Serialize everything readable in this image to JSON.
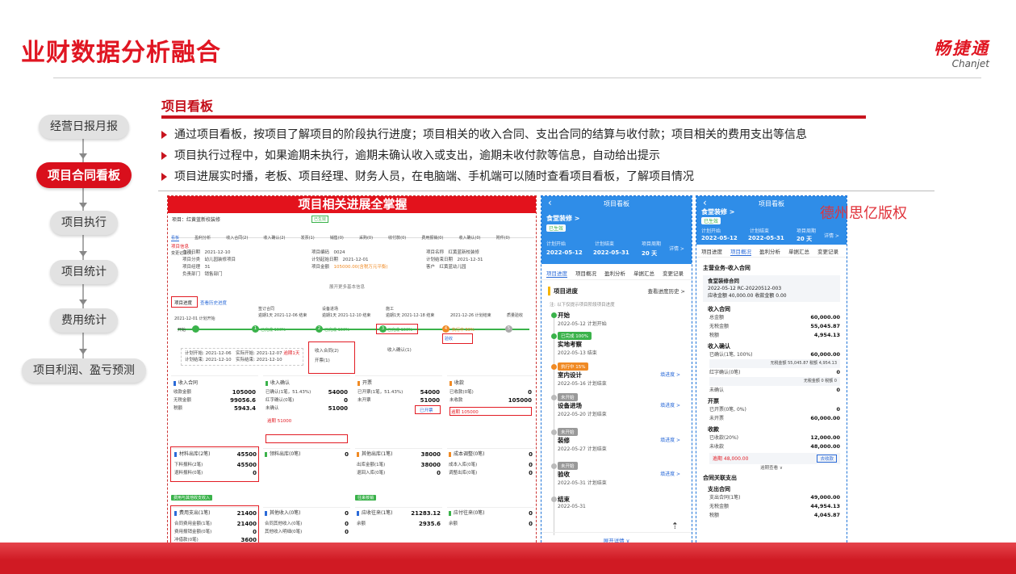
{
  "slide": {
    "title": "业财数据分析融合",
    "logo_cn": "畅捷通",
    "logo_en": "Chanjet"
  },
  "flow": {
    "steps": [
      {
        "label": "经营日报月报",
        "active": false
      },
      {
        "label": "项目合同看板",
        "active": true
      },
      {
        "label": "项目执行",
        "active": false
      },
      {
        "label": "项目统计",
        "active": false
      },
      {
        "label": "费用统计",
        "active": false
      },
      {
        "label": "项目利润、盈亏预测",
        "active": false
      }
    ]
  },
  "section": {
    "heading": "项目看板",
    "bullets": [
      "通过项目看板，按项目了解项目的阶段执行进度；项目相关的收入合同、支出合同的结算与收付款；项目相关的费用支出等信息",
      "项目执行过程中，如果逾期未执行，逾期未确认收入或支出，逾期未收付款等信息，自动给出提示",
      "项目进展实时播，老板、项目经理、财务人员，在电脑端、手机端可以随时查看项目看板，了解项目情况"
    ]
  },
  "pc": {
    "banner": "项目相关进展全掌握",
    "project": "项目：红黄蓝新校装修",
    "status": "已生效",
    "tabs": [
      "看板",
      "盈利分析",
      "收入合同(2)",
      "收入确认(2)",
      "发票(1)",
      "销售(0)",
      "采购(0)",
      "收付款(0)",
      "费用报销(0)",
      "收入确认(0)",
      "附件(0)",
      "变更记录(0)"
    ],
    "info_label": "项目信息",
    "info": [
      [
        "立项日期",
        "2021-12-10"
      ],
      [
        "项目分类",
        "幼儿园装修项目"
      ],
      [
        "项目经理",
        "31"
      ],
      [
        "负责部门",
        "销售部门"
      ]
    ],
    "info2": [
      [
        "项目编码",
        "0024"
      ],
      [
        "计划起始日期",
        "2021-12-01"
      ],
      [
        "项目金额",
        "105000.00(含税万元平衡)"
      ]
    ],
    "info3": [
      [
        "项目名称",
        "红黄蓝新校装修"
      ],
      [
        "计划结束日期",
        "2021-12-31"
      ],
      [
        "客户",
        "红黄蓝幼儿园"
      ]
    ],
    "expand": "展开更多基本信息",
    "progress_label": "项目进度",
    "progress_link": "查看历史进度",
    "stages": [
      {
        "name": "开始",
        "date": "2021-12-01 计划开始",
        "state": "done"
      },
      {
        "name": "签订合同",
        "date": "逾期1天 2021-12-06 结束",
        "state": "done",
        "badge": "已完成 100%"
      },
      {
        "name": "设备进场",
        "date": "逾期1天 2021-12-10 结束",
        "state": "done",
        "badge": "已完成 100%"
      },
      {
        "name": "施工",
        "date": "逾期1天 2021-12-18 结束",
        "state": "done",
        "badge": "已完成 100%"
      },
      {
        "name": "验收",
        "date": "2021-12-26 计划结束",
        "state": "doing",
        "badge": "执行中 50%"
      },
      {
        "name": "质量验收",
        "date": "2021-12-31",
        "state": "todo"
      }
    ],
    "plan_lines": [
      "计划开始: 2021-12-06",
      "计划结束: 2021-12-10",
      "实际开始: 2021-12-07",
      "实际结束: 2021-12-10",
      "逾期1天"
    ],
    "sub_links": [
      "收入合同(2)",
      "开票(1)",
      "收入确认(1)"
    ],
    "cards_row1": [
      {
        "title": "收入合同",
        "color": "blue",
        "lines": [
          [
            "收款金额",
            "105000"
          ],
          [
            "无税金额",
            "99056.6"
          ],
          [
            "税额",
            "5943.4"
          ]
        ]
      },
      {
        "title": "收入确认",
        "color": "green",
        "lines": [
          [
            "已确认(1笔，51.43%)",
            "54000"
          ],
          [
            "红字确认(0笔)",
            "0"
          ],
          [
            "未确认",
            "51000"
          ]
        ],
        "alert": "逾期 51000"
      },
      {
        "title": "开票",
        "color": "orange",
        "lines": [
          [
            "已开票(1笔，51.43%)",
            "54000"
          ],
          [
            "未开票",
            "51000"
          ]
        ],
        "alert": "已开票"
      },
      {
        "title": "收款",
        "color": "orange",
        "lines": [
          [
            "已收款(0笔)",
            "0"
          ],
          [
            "未收款",
            "105000"
          ]
        ],
        "alert": "逾期 105000"
      }
    ],
    "cards_row2": [
      {
        "title": "材料出库(2笔)",
        "lines": [
          [
            "下料报料(2笔)",
            "45500"
          ],
          [
            "退料报料(0笔)",
            "0"
          ]
        ],
        "value": "45500"
      },
      {
        "title": "领料出库(0笔)",
        "lines": [],
        "value": "0"
      },
      {
        "title": "其他出库(1笔)",
        "lines": [
          [
            "出库金额(1笔)",
            "38000"
          ],
          [
            "退回入库(0笔)",
            "0"
          ]
        ],
        "value": "38000"
      },
      {
        "title": "成本调整(0笔)",
        "lines": [
          [
            "成本入库(0笔)",
            "0"
          ],
          [
            "调整出库(0笔)",
            "0"
          ]
        ],
        "value": "0"
      }
    ],
    "section_tags": [
      "费用与其他收支收入",
      "往来核销"
    ],
    "cards_row3": [
      {
        "title": "费用支出(1笔)",
        "value": "21400",
        "lines": [
          [
            "合同费用金额(1笔)",
            "21400"
          ],
          [
            "费用报销金额(0笔)",
            "0"
          ],
          [
            "冲借款(0笔)",
            "3600"
          ]
        ]
      },
      {
        "title": "其他收入(0笔)",
        "value": "0",
        "lines": [
          [
            "合同其他收入(0笔)",
            "0"
          ],
          [
            "其他收入明细(0笔)",
            "0"
          ]
        ]
      },
      {
        "title": "应收往来(1笔)",
        "value": "21283.12",
        "lines": [
          [
            "余额",
            "2935.6"
          ]
        ]
      },
      {
        "title": "应付往来(0笔)",
        "value": "0",
        "lines": [
          [
            "余额",
            "0"
          ]
        ]
      }
    ]
  },
  "phone1": {
    "header": "项目看板",
    "project": "食堂装修 >",
    "status": "已生效",
    "meta": [
      {
        "label": "计划开始",
        "value": "2022-05-12"
      },
      {
        "label": "计划结束",
        "value": "2022-05-31"
      },
      {
        "label": "项目周期",
        "value": "20 天"
      }
    ],
    "detail": "详情 >",
    "tabs": [
      "项目进度",
      "项目概况",
      "盈利分析",
      "单据汇总",
      "变更记录"
    ],
    "section": "项目进度",
    "history": "查看进度历史 >",
    "hint": "注: 以下仅提示项目阶段项目进度",
    "steps": [
      {
        "name": "开始",
        "date": "2022-05-12",
        "note": "计划开始",
        "badge": ""
      },
      {
        "name": "实地考察",
        "date": "2022-05-13",
        "note": "结束",
        "badge": "已完成 100%",
        "badge_color": "#3ab24a"
      },
      {
        "name": "室内设计",
        "date": "2022-05-16",
        "note": "计划结束",
        "badge": "执行中 15%",
        "badge_color": "#f08a24",
        "link": "填进度 >"
      },
      {
        "name": "设备进场",
        "date": "2022-05-20",
        "note": "计划结束",
        "badge": "未开始",
        "badge_color": "#999",
        "link": "填进度 >"
      },
      {
        "name": "装修",
        "date": "2022-05-27",
        "note": "计划结束",
        "badge": "未开始",
        "badge_color": "#999",
        "link": "填进度 >"
      },
      {
        "name": "验收",
        "date": "2022-05-31",
        "note": "计划结束",
        "badge": "未开始",
        "badge_color": "#999",
        "link": "填进度 >"
      },
      {
        "name": "结束",
        "date": "2022-05-31",
        "note": "",
        "badge": ""
      }
    ],
    "footer": "展开详情 ∨"
  },
  "phone2": {
    "header": "项目看板",
    "project": "食堂装修 >",
    "status": "已生效",
    "meta": [
      {
        "label": "计划开始",
        "value": "2022-05-12"
      },
      {
        "label": "计划结束",
        "value": "2022-05-31"
      },
      {
        "label": "项目周期",
        "value": "20 天"
      }
    ],
    "detail": "详情 >",
    "tabs": [
      "项目进度",
      "项目概况",
      "盈利分析",
      "单据汇总",
      "变更记录"
    ],
    "group1": "主营业务-收入合同",
    "contract_name": "食堂装修合同",
    "contract_line1": "2022-05-12  RC-20220512-003",
    "contract_line2": "应收金额 40,000.00 收款金额 0.00",
    "income_title": "收入合同",
    "income_lines": [
      [
        "总金额",
        "60,000.00"
      ],
      [
        "无税金额",
        "55,045.87"
      ],
      [
        "税额",
        "4,954.13"
      ]
    ],
    "confirm_title": "收入确认",
    "confirm_lines": [
      [
        "已确认(1笔, 100%)",
        "60,000.00"
      ],
      [
        "无税金额 55,045.87 税额 4,954.13",
        ""
      ],
      [
        "红字确认(0笔)",
        "0"
      ],
      [
        "无税金额 0 税额 0",
        ""
      ],
      [
        "未确认",
        "0"
      ]
    ],
    "invoice_title": "开票",
    "invoice_lines": [
      [
        "已开票(0笔, 0%)",
        "0"
      ],
      [
        "未开票",
        "60,000.00"
      ]
    ],
    "receive_title": "收款",
    "receive_lines": [
      [
        "已收款(20%)",
        "12,000.00"
      ],
      [
        "未收款",
        "48,000.00"
      ]
    ],
    "overdue": "逾期 48,000.00",
    "overdue_btn": "去收款",
    "overdue_more": "逾期查看 ∨",
    "group2": "合同关联支出",
    "expense_title": "支出合同",
    "expense_lines": [
      [
        "支出合同(1笔)",
        "49,000.00"
      ],
      [
        "无税金额",
        "44,954.13"
      ],
      [
        "税额",
        "4,045.87"
      ]
    ]
  },
  "watermark": "德州思亿版权"
}
